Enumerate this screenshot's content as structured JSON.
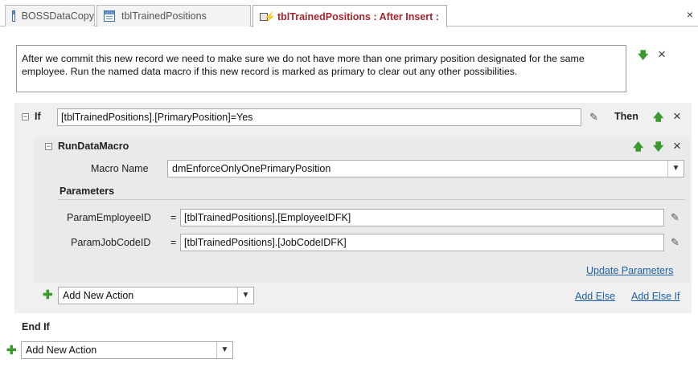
{
  "tabs": [
    {
      "label": "BOSSDataCopy",
      "icon": "database-icon"
    },
    {
      "label": "tblTrainedPositions",
      "icon": "table-icon"
    },
    {
      "label": "tblTrainedPositions : After Insert :",
      "icon": "data-macro-icon",
      "active": true
    }
  ],
  "close_glyph": "×",
  "comment": "After we commit this new record we need to make sure we do not have more than one primary position designated for the same employee. Run the named data macro if this new record is marked as primary to clear out any other possibilities.",
  "if_block": {
    "keyword": "If",
    "condition": "[tblTrainedPositions].[PrimaryPosition]=Yes",
    "then_label": "Then",
    "end_label": "End If"
  },
  "run_data_macro": {
    "action_name": "RunDataMacro",
    "macro_name_label": "Macro Name",
    "macro_name_value": "dmEnforceOnlyOnePrimaryPosition",
    "parameters_label": "Parameters",
    "params": [
      {
        "name": "ParamEmployeeID",
        "eq": "=",
        "value": "[tblTrainedPositions].[EmployeeIDFK]"
      },
      {
        "name": "ParamJobCodeID",
        "eq": "=",
        "value": "[tblTrainedPositions].[JobCodeIDFK]"
      }
    ],
    "update_parameters": "Update Parameters"
  },
  "inner_add_action": "Add New Action",
  "add_else": "Add Else",
  "add_else_if": "Add Else If",
  "outer_add_action": "Add New Action",
  "colors": {
    "accent": "#a4262c",
    "green_arrow": "#3a9a2e",
    "link": "#1d5fa5"
  }
}
